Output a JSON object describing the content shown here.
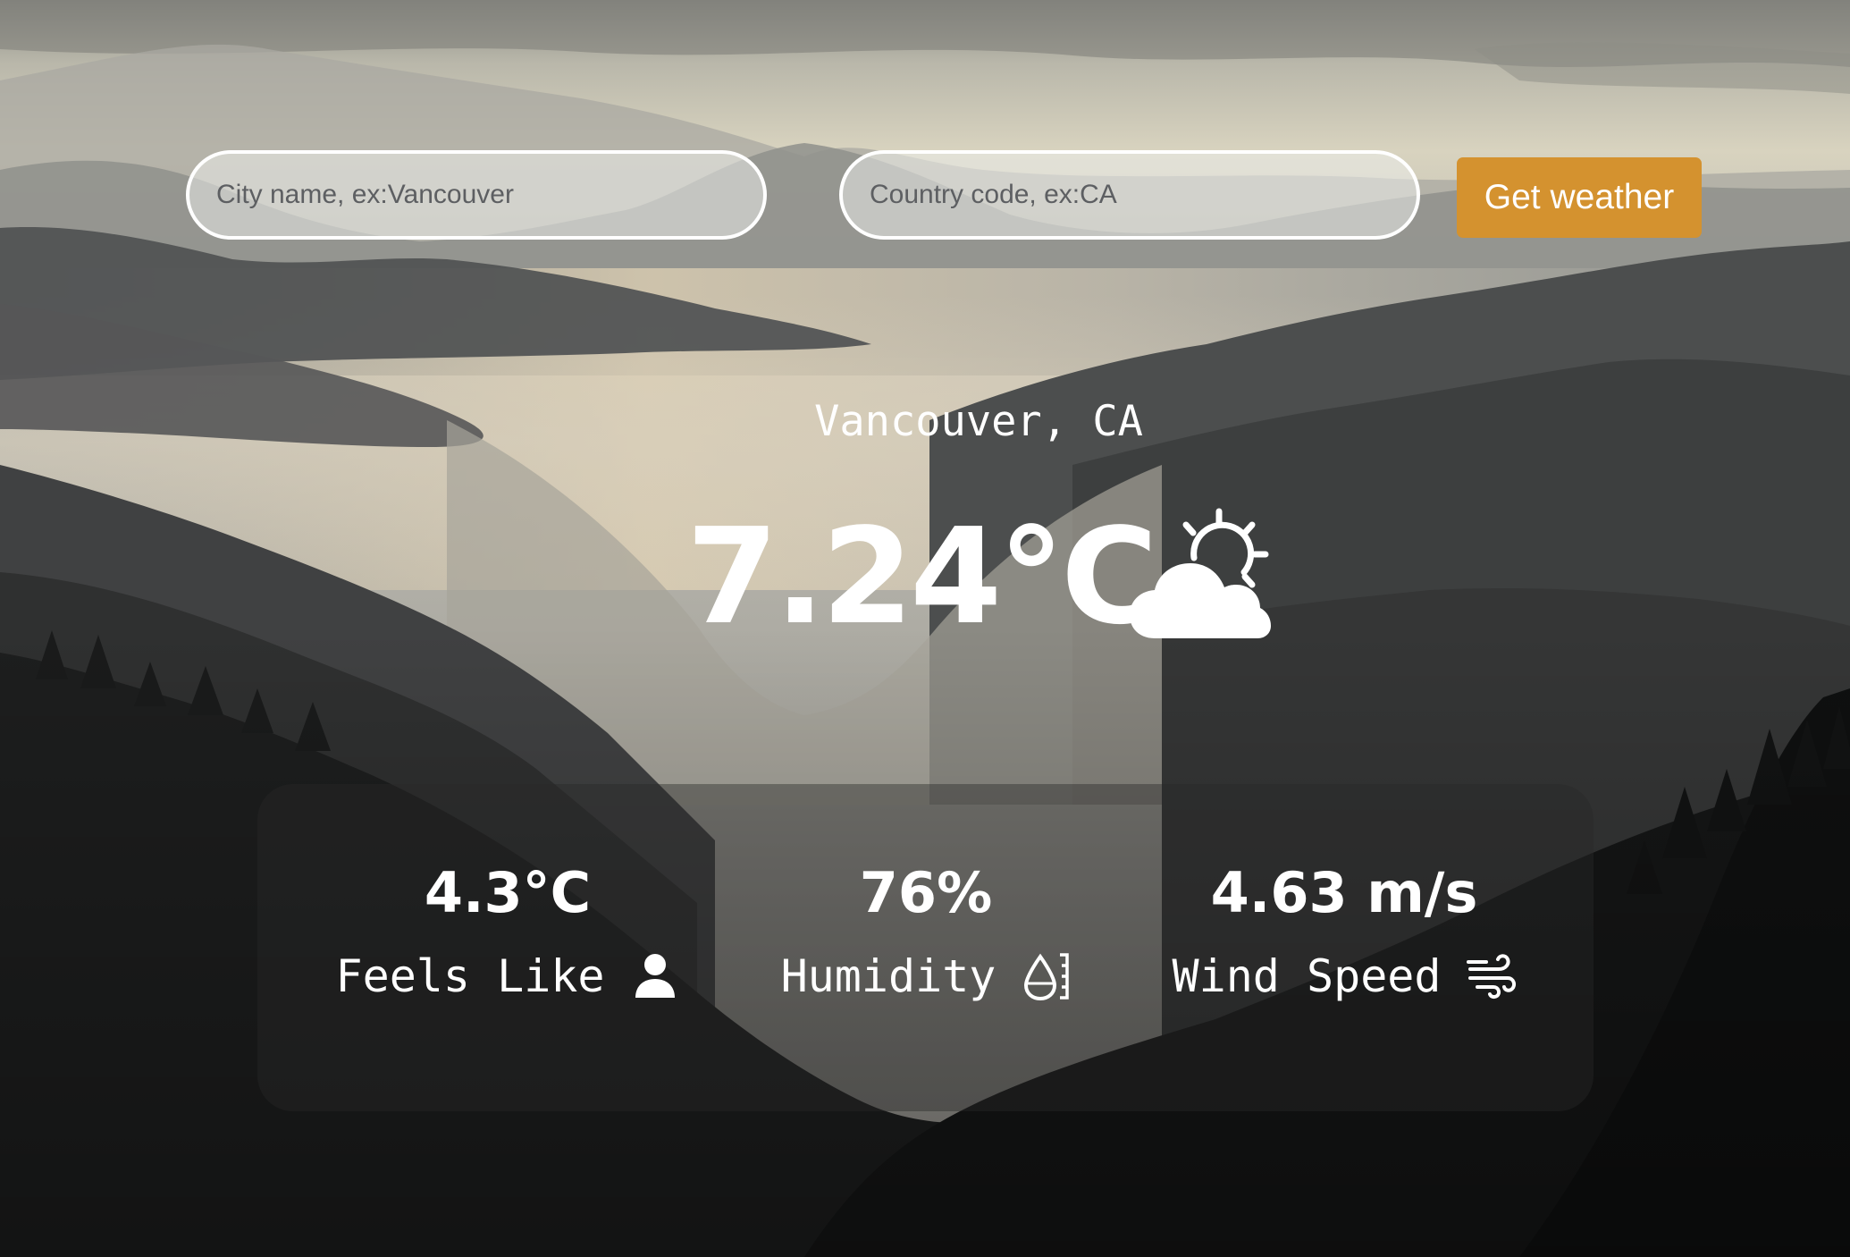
{
  "search": {
    "city_placeholder": "City name, ex:Vancouver",
    "country_placeholder": "Country code, ex:CA",
    "button_label": "Get weather"
  },
  "current": {
    "location": "Vancouver, CA",
    "temperature": "7.24°C",
    "condition_icon": "partly-cloudy-icon"
  },
  "details": {
    "feels_like": {
      "value": "4.3°C",
      "label": "Feels Like",
      "icon": "person-icon"
    },
    "humidity": {
      "value": "76%",
      "label": "Humidity",
      "icon": "humidity-icon"
    },
    "wind_speed": {
      "value": "4.63 m/s",
      "label": "Wind Speed",
      "icon": "wind-icon"
    }
  },
  "colors": {
    "button_accent": "#d4922f",
    "text": "#ffffff",
    "input_border": "#ffffff"
  }
}
